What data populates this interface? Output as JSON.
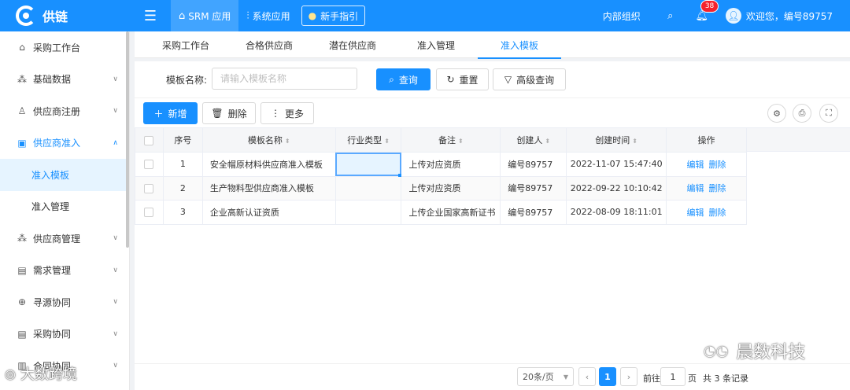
{
  "app": {
    "brand": "供链"
  },
  "topnav": {
    "items": [
      {
        "label": "SRM 应用",
        "icon": "rocket-icon",
        "active": true
      },
      {
        "label": "系统应用",
        "icon": "sliders-icon",
        "active": false
      }
    ],
    "guide_label": "新手指引",
    "org_label": "内部组织",
    "notification_count": "38",
    "welcome": "欢迎您，编号89757"
  },
  "sidebar": {
    "items": [
      {
        "label": "采购工作台",
        "icon": "home-icon"
      },
      {
        "label": "基础数据",
        "icon": "cluster-icon"
      },
      {
        "label": "供应商注册",
        "icon": "user-icon"
      },
      {
        "label": "供应商准入",
        "icon": "id-card-icon"
      },
      {
        "label": "准入模板"
      },
      {
        "label": "准入管理"
      },
      {
        "label": "供应商管理",
        "icon": "apartment-icon"
      },
      {
        "label": "需求管理",
        "icon": "file-icon"
      },
      {
        "label": "寻源协同",
        "icon": "globe-icon"
      },
      {
        "label": "采购协同",
        "icon": "doc-icon"
      },
      {
        "label": "合同协同",
        "icon": "contract-icon"
      }
    ]
  },
  "tabs": [
    {
      "label": "采购工作台"
    },
    {
      "label": "合格供应商"
    },
    {
      "label": "潜在供应商"
    },
    {
      "label": "准入管理"
    },
    {
      "label": "准入模板"
    }
  ],
  "filters": {
    "name_label": "模板名称:",
    "name_placeholder": "请输入模板名称",
    "search_label": "查询",
    "reset_label": "重置",
    "advanced_label": "高级查询"
  },
  "toolbar": {
    "add_label": "新增",
    "delete_label": "删除",
    "more_label": "更多"
  },
  "table": {
    "headers": {
      "index": "序号",
      "name": "模板名称",
      "industry": "行业类型",
      "remark": "备注",
      "creator": "创建人",
      "created": "创建时间",
      "ops": "操作"
    },
    "edit_label": "编辑",
    "delete_label": "删除",
    "rows": [
      {
        "index": "1",
        "name": "安全帽原材料供应商准入模板",
        "industry": "",
        "remark": "上传对应资质",
        "creator": "编号89757",
        "created": "2022-11-07 15:47:40"
      },
      {
        "index": "2",
        "name": "生产物料型供应商准入模板",
        "industry": "",
        "remark": "上传对应资质",
        "creator": "编号89757",
        "created": "2022-09-22 10:10:42"
      },
      {
        "index": "3",
        "name": "企业高新认证资质",
        "industry": "",
        "remark": "上传企业国家高新证书",
        "creator": "编号89757",
        "created": "2022-08-09 18:11:01"
      }
    ]
  },
  "pagination": {
    "page_size": "20条/页",
    "current_page": "1",
    "goto_label": "前往",
    "goto_value": "1",
    "page_unit": "页",
    "total_text": "共 3 条记录"
  },
  "watermarks": {
    "right": "晨数科技",
    "left": "大数跨境"
  }
}
